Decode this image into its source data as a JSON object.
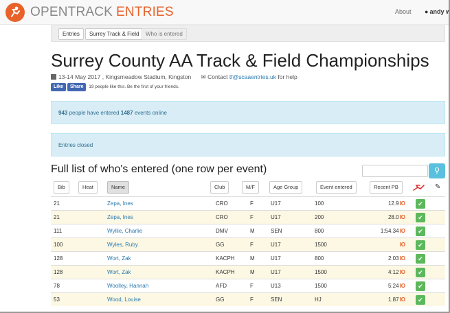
{
  "navbar": {
    "brand_part1": "OPENTRACK",
    "brand_part2": "ENTRIES",
    "about": "About",
    "user": "andy w",
    "logo_icon": "runner-icon",
    "user_icon": "user-icon"
  },
  "tabs": [
    {
      "label": "Entries"
    },
    {
      "label": "Surrey Track & Field"
    },
    {
      "label": "Who is entered"
    }
  ],
  "title": "Surrey County AA Track & Field Championships",
  "meta": {
    "date_venue": "13-14 May 2017 , Kingsmeadow Stadium, Kingston",
    "contact_prefix": "Contact",
    "contact_email": "tf@scaaentries.uk",
    "contact_suffix": "for help",
    "calendar_icon": "calendar-icon",
    "envelope_icon": "envelope-icon"
  },
  "social": {
    "like": "Like",
    "share": "Share",
    "text": "19 people like this. Be the first of your friends."
  },
  "alerts": {
    "people_count": "943",
    "people_text": "people have entered",
    "events_count": "1487",
    "events_text": "events online",
    "closed": "Entries closed"
  },
  "list_title": "Full list of who's entered (one row per event)",
  "search": {
    "icon": "search-icon"
  },
  "columns": {
    "bib": "Bib",
    "heat": "Heat",
    "name": "Name",
    "club": "Club",
    "mf": "M/F",
    "age_group": "Age Group",
    "event_entered": "Event entered",
    "recent_pb": "Recent PB",
    "paid_icon": "runner-icon",
    "edit_icon": "pencil-icon"
  },
  "rows": [
    {
      "bib": "21",
      "name": "Zepa, Ines",
      "club": "CRO",
      "mf": "F",
      "age": "U17",
      "event": "100",
      "pb": "12.9"
    },
    {
      "bib": "21",
      "name": "Zepa, Ines",
      "club": "CRO",
      "mf": "F",
      "age": "U17",
      "event": "200",
      "pb": "28.0"
    },
    {
      "bib": "111",
      "name": "Wyllie, Charlie",
      "club": "DMV",
      "mf": "M",
      "age": "SEN",
      "event": "800",
      "pb": "1:54.34"
    },
    {
      "bib": "100",
      "name": "Wyles, Ruby",
      "club": "GG",
      "mf": "F",
      "age": "U17",
      "event": "1500",
      "pb": ""
    },
    {
      "bib": "128",
      "name": "Wort, Zak",
      "club": "KACPH",
      "mf": "M",
      "age": "U17",
      "event": "800",
      "pb": "2:03"
    },
    {
      "bib": "128",
      "name": "Wort, Zak",
      "club": "KACPH",
      "mf": "M",
      "age": "U17",
      "event": "1500",
      "pb": "4:12"
    },
    {
      "bib": "78",
      "name": "Woolley, Hannah",
      "club": "AFD",
      "mf": "F",
      "age": "U13",
      "event": "1500",
      "pb": "5:24"
    },
    {
      "bib": "53",
      "name": "Wood, Louise",
      "club": "GG",
      "mf": "F",
      "age": "SEN",
      "event": "HJ",
      "pb": "1.87"
    }
  ],
  "pb_badge": "IO",
  "check_icon": "checkmark-icon",
  "colors": {
    "brand_orange": "#e8622a",
    "link_blue": "#2a7ab0",
    "alert_bg": "#d9edf7",
    "row_stripe": "#fcf8e3",
    "check_green": "#5cb85c",
    "search_btn": "#5bc0de"
  }
}
